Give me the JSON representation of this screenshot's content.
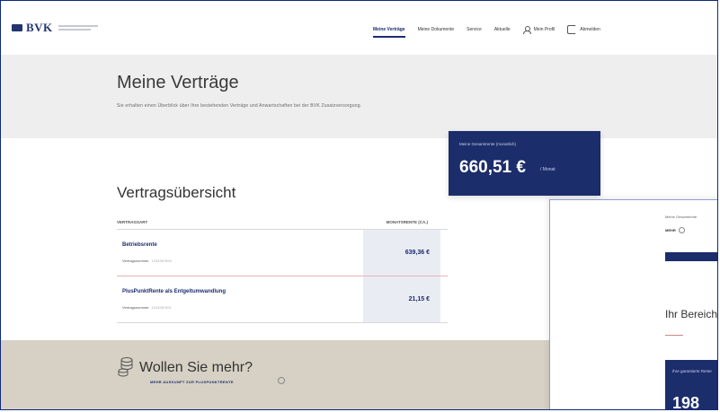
{
  "header": {
    "logo_text": "BVK",
    "nav": [
      {
        "label": "Meine Verträge",
        "active": true
      },
      {
        "label": "Meine Dokumente",
        "active": false
      },
      {
        "label": "Service",
        "active": false
      },
      {
        "label": "Aktuelle",
        "active": false
      }
    ],
    "profile_label": "Mein Profil",
    "logout_label": "Abmelden"
  },
  "banner": {
    "title": "Meine Verträge",
    "subtitle": "Sie erhalten einen Überblick über Ihre bestehenden Verträge und Anwartschaften bei der BVK Zusatzversorgung."
  },
  "total": {
    "label": "Meine Gesamtrente (monatlich)",
    "amount": "660,51 €",
    "period": "/ Monat"
  },
  "overview": {
    "title": "Vertragsübersicht",
    "col_left": "VERTRAGSART",
    "col_right": "MONATSRENTE (CA.)",
    "rows": [
      {
        "name": "Betriebsrente",
        "meta_key": "Vertragsnummer",
        "meta_value": "1234567890",
        "amount": "639,36 €"
      },
      {
        "name": "PlusPunktRente als Entgeltumwandlung",
        "meta_key": "Vertragsnummer",
        "meta_value": "1234567891",
        "amount": "21,15 €"
      }
    ]
  },
  "promo": {
    "title": "Wollen Sie mehr?",
    "link": "MEHR AUSKUNFT ZUR PLUSPUNKTRENTE"
  },
  "panel": {
    "top_label": "Meine Gesamtrente",
    "top_value": "MEHR",
    "heading": "Ihr Bereich",
    "box_label": "Ihre garantierte Rente",
    "box_number": "198"
  },
  "colors": {
    "brand_navy": "#1c2d6b",
    "banner_gray": "#eeeeee",
    "promo_beige": "#d6d1c4"
  }
}
